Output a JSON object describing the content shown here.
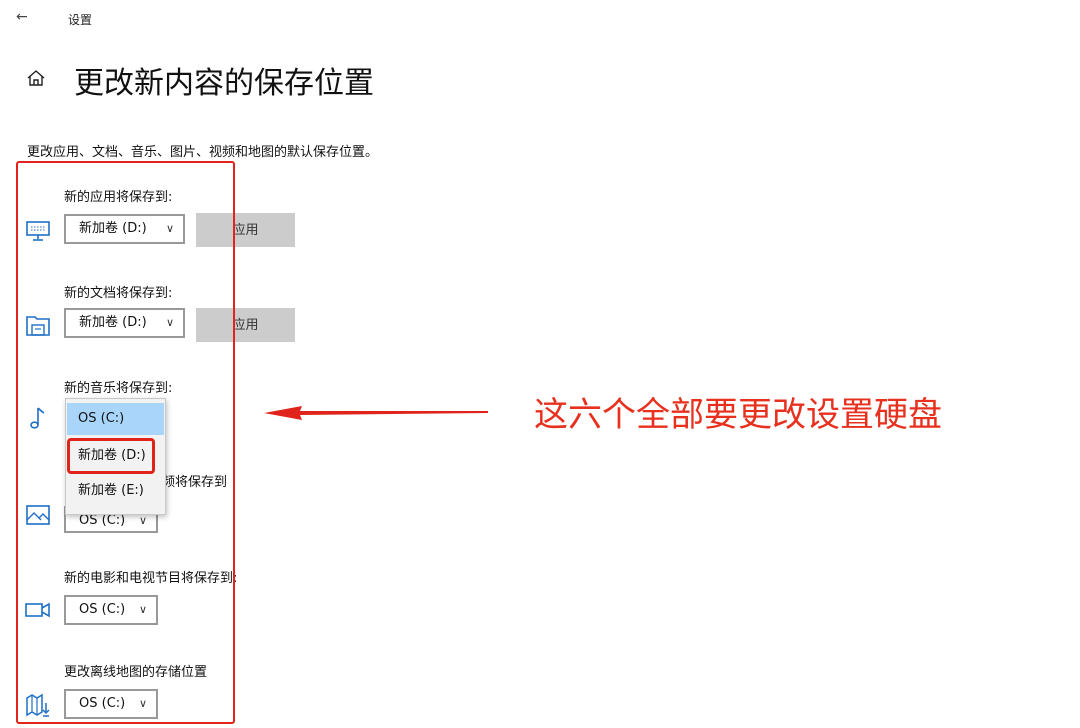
{
  "titlebar": {
    "back_icon": "back-arrow-icon",
    "title": "设置"
  },
  "header": {
    "home_icon": "home-icon",
    "title": "更改新内容的保存位置"
  },
  "description": "更改应用、文档、音乐、图片、视频和地图的默认保存位置。",
  "settings": [
    {
      "label": "新的应用将保存到:",
      "icon": "monitor-icon",
      "value": "新加卷 (D:)",
      "apply": "应用"
    },
    {
      "label": "新的文档将保存到:",
      "icon": "documents-folder-icon",
      "value": "新加卷 (D:)",
      "apply": "应用"
    },
    {
      "label": "新的音乐将保存到:",
      "icon": "music-note-icon"
    },
    {
      "label_visible_part": "频将保存到",
      "icon": "picture-icon",
      "value": "OS (C:)"
    },
    {
      "label": "新的电影和电视节目将保存到:",
      "icon": "video-camera-icon",
      "value": "OS (C:)"
    },
    {
      "label": "更改离线地图的存储位置",
      "icon": "map-download-icon",
      "value": "OS (C:)"
    }
  ],
  "music_dropdown_open": {
    "options": [
      "OS (C:)",
      "新加卷 (D:)",
      "新加卷 (E:)"
    ],
    "highlighted": "OS (C:)"
  },
  "annotation": {
    "text": "这六个全部要更改设置硬盘",
    "color": "#e8301e"
  },
  "colors": {
    "highlight": "#a9d5fb",
    "button_bg": "#cccccc",
    "annotation_red": "#e0241b"
  }
}
